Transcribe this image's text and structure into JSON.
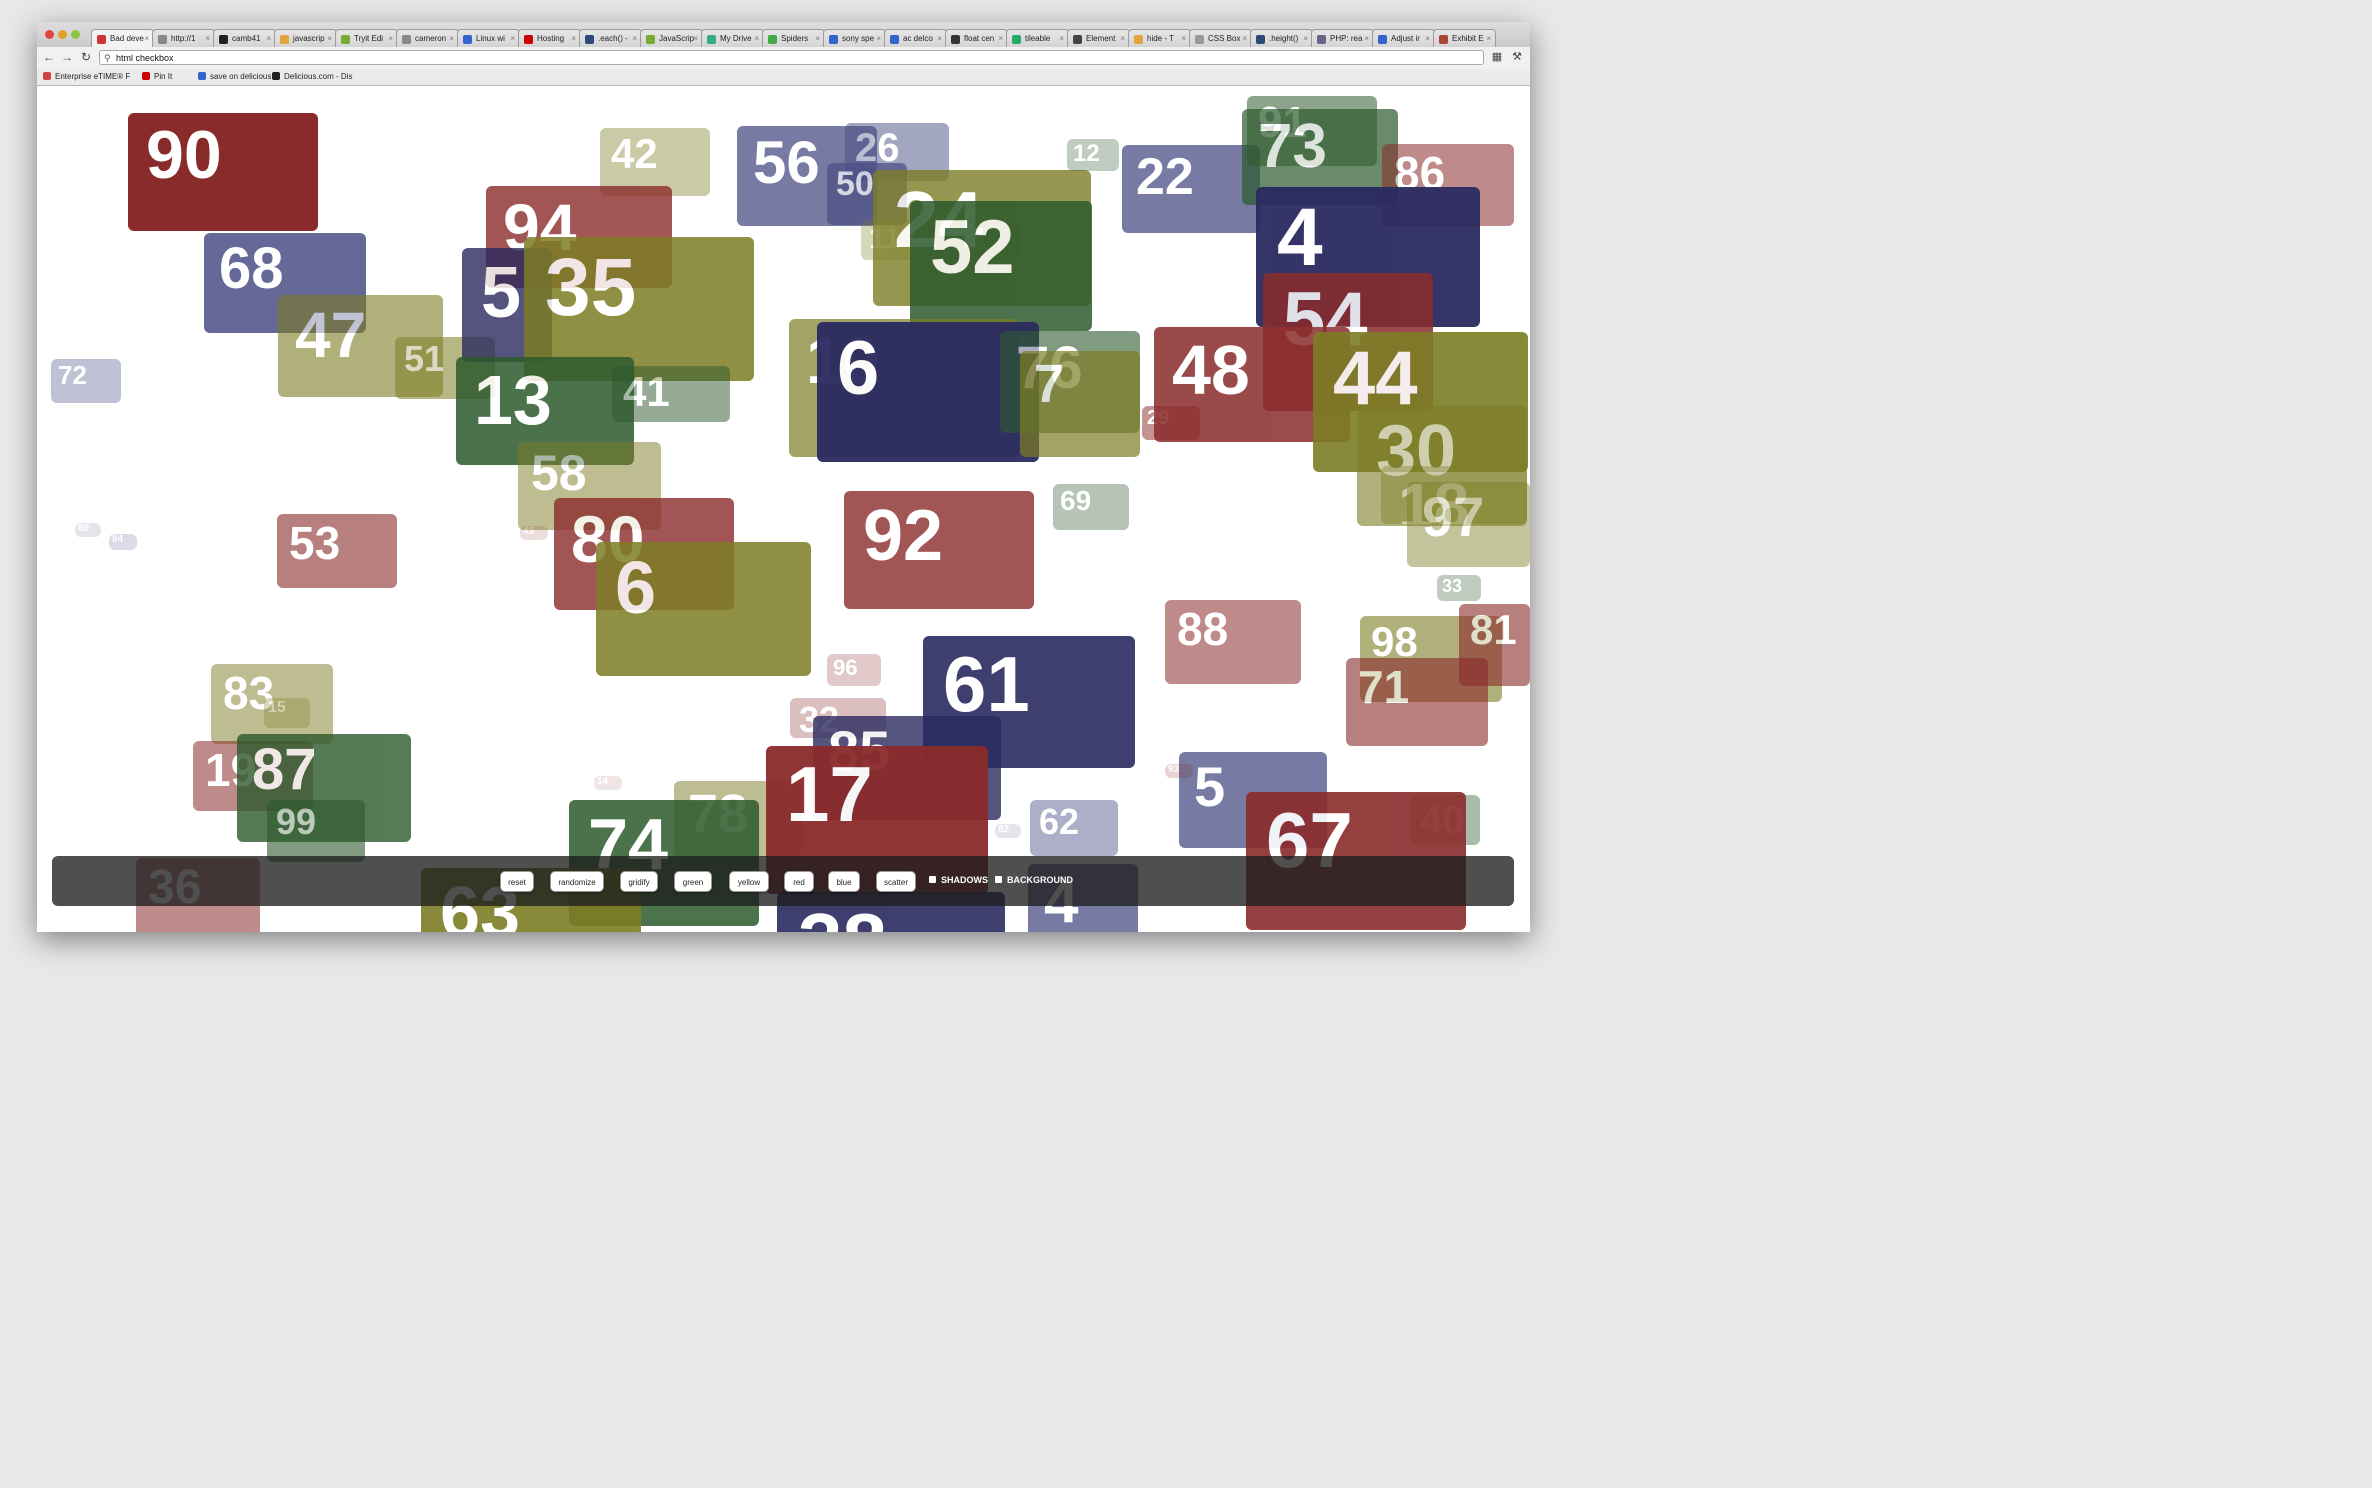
{
  "browser": {
    "tabs": [
      {
        "label": "Bad deve",
        "fav": "#c33"
      },
      {
        "label": "http://1",
        "fav": "#888"
      },
      {
        "label": "camb41",
        "fav": "#222"
      },
      {
        "label": "javascrip",
        "fav": "#e2a33b"
      },
      {
        "label": "Tryit Edi",
        "fav": "#7a3"
      },
      {
        "label": "cameron",
        "fav": "#888"
      },
      {
        "label": "Linux wi",
        "fav": "#36c"
      },
      {
        "label": "Hosting",
        "fav": "#c00"
      },
      {
        "label": ".each() -",
        "fav": "#2b4a7a"
      },
      {
        "label": "JavaScrip",
        "fav": "#7a3"
      },
      {
        "label": "My Drive",
        "fav": "#3a8"
      },
      {
        "label": "Spiders",
        "fav": "#4a4"
      },
      {
        "label": "sony spe",
        "fav": "#36c"
      },
      {
        "label": "ac delco",
        "fav": "#36c"
      },
      {
        "label": "float cen",
        "fav": "#333"
      },
      {
        "label": "tileable",
        "fav": "#2a6"
      },
      {
        "label": "Element",
        "fav": "#444"
      },
      {
        "label": "hide - T",
        "fav": "#e2a33b"
      },
      {
        "label": "CSS Box",
        "fav": "#999"
      },
      {
        "label": ".height()",
        "fav": "#2b4a7a"
      },
      {
        "label": "PHP: rea",
        "fav": "#668"
      },
      {
        "label": "Adjust ir",
        "fav": "#36c"
      },
      {
        "label": "Exhibit E",
        "fav": "#a43"
      }
    ],
    "url": "html checkbox",
    "bookmarks": [
      {
        "label": "Enterprise eTIME® F",
        "color": "#c44"
      },
      {
        "label": "Pin It",
        "color": "#c00"
      },
      {
        "label": "save on delicious",
        "color": "#36c"
      },
      {
        "label": "Delicious.com - Dis",
        "color": "#222"
      }
    ]
  },
  "colors": {
    "red": "#8a2b2b",
    "blue": "#2a2a60",
    "green": "#2d5a2d",
    "olive": "#7d7d25",
    "slate": "#4a4f85"
  },
  "tiles": [
    {
      "n": "90"
    },
    {
      "n": "68"
    },
    {
      "n": "47"
    },
    {
      "n": "72"
    },
    {
      "n": "51"
    },
    {
      "n": "42"
    },
    {
      "n": "94"
    },
    {
      "n": "5"
    },
    {
      "n": "35"
    },
    {
      "n": "13"
    },
    {
      "n": "41"
    },
    {
      "n": "58"
    },
    {
      "n": "56"
    },
    {
      "n": "26"
    },
    {
      "n": "50"
    },
    {
      "n": "11"
    },
    {
      "n": "24"
    },
    {
      "n": "52"
    },
    {
      "n": "12"
    },
    {
      "n": "22"
    },
    {
      "n": "91"
    },
    {
      "n": "73"
    },
    {
      "n": "86"
    },
    {
      "n": "4"
    },
    {
      "n": "54"
    },
    {
      "n": "10"
    },
    {
      "n": "6"
    },
    {
      "n": "76"
    },
    {
      "n": "7"
    },
    {
      "n": "29"
    },
    {
      "n": "48"
    },
    {
      "n": "44"
    },
    {
      "n": "30"
    },
    {
      "n": "18"
    },
    {
      "n": "97"
    },
    {
      "n": "69"
    },
    {
      "n": "53"
    },
    {
      "n": "89"
    },
    {
      "n": "84"
    },
    {
      "n": "43"
    },
    {
      "n": "80"
    },
    {
      "n": "6"
    },
    {
      "n": "92"
    },
    {
      "n": "33"
    },
    {
      "n": "88"
    },
    {
      "n": "98"
    },
    {
      "n": "81"
    },
    {
      "n": "71"
    },
    {
      "n": "96"
    },
    {
      "n": "61"
    },
    {
      "n": "32"
    },
    {
      "n": "85"
    },
    {
      "n": "83"
    },
    {
      "n": "15"
    },
    {
      "n": "19"
    },
    {
      "n": "87"
    },
    {
      "n": "99"
    },
    {
      "n": "36"
    },
    {
      "n": "14"
    },
    {
      "n": "78"
    },
    {
      "n": "74"
    },
    {
      "n": "17"
    },
    {
      "n": "62"
    },
    {
      "n": "82"
    },
    {
      "n": "5"
    },
    {
      "n": "93"
    },
    {
      "n": "40"
    },
    {
      "n": "67"
    },
    {
      "n": "63"
    },
    {
      "n": "38"
    },
    {
      "n": "4"
    }
  ],
  "controls": {
    "buttons": [
      "reset",
      "randomize",
      "gridify",
      "green",
      "yellow",
      "red",
      "blue",
      "scatter"
    ],
    "checks": [
      "SHADOWS",
      "BACKGROUND"
    ]
  }
}
